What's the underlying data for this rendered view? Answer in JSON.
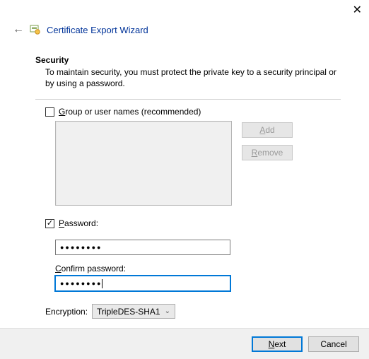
{
  "header": {
    "title": "Certificate Export Wizard"
  },
  "security": {
    "heading": "Security",
    "description": "To maintain security, you must protect the private key to a security principal or by using a password.",
    "group_checkbox": {
      "underline": "G",
      "rest": "roup or user names (recommended)"
    },
    "password_checkbox": {
      "underline": "P",
      "rest": "assword:"
    }
  },
  "buttons": {
    "add": {
      "underline": "A",
      "rest": "dd"
    },
    "remove": {
      "underline": "R",
      "rest": "emove"
    }
  },
  "fields": {
    "password": {
      "masked": "●●●●●●●●"
    },
    "confirm": {
      "label_underline": "C",
      "label_rest": "onfirm password:",
      "masked": "●●●●●●●●"
    },
    "encryption": {
      "label": "Encryption:",
      "value": "TripleDES-SHA1"
    }
  },
  "footer": {
    "next": {
      "underline": "N",
      "rest": "ext"
    },
    "cancel": "Cancel"
  }
}
